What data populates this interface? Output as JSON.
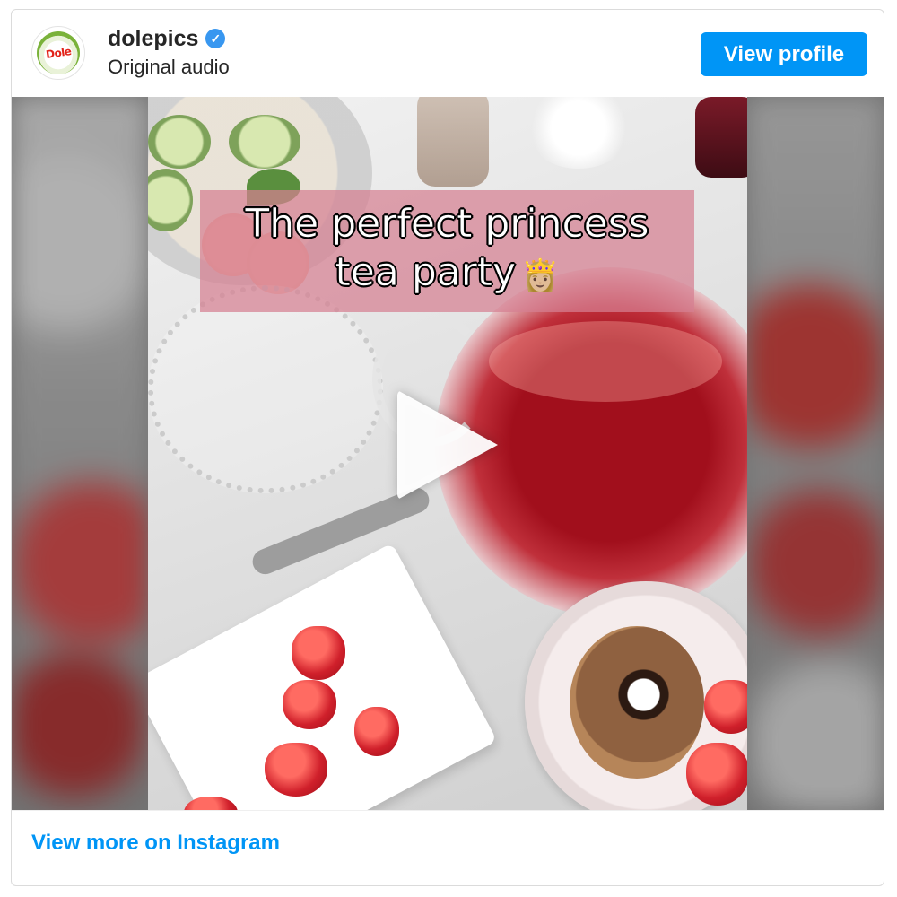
{
  "header": {
    "logo_text": "Dole",
    "username": "dolepics",
    "verified_icon": "verified-badge-icon",
    "subtitle": "Original audio",
    "view_profile_label": "View profile"
  },
  "media": {
    "caption_line1": "The perfect princess",
    "caption_line2": "tea party",
    "caption_emoji": "👸🏼",
    "play_icon": "play-icon"
  },
  "footer": {
    "link_label": "View more on Instagram"
  },
  "colors": {
    "accent": "#0095f6",
    "verified": "#3897f0",
    "caption_background": "#d68092"
  }
}
